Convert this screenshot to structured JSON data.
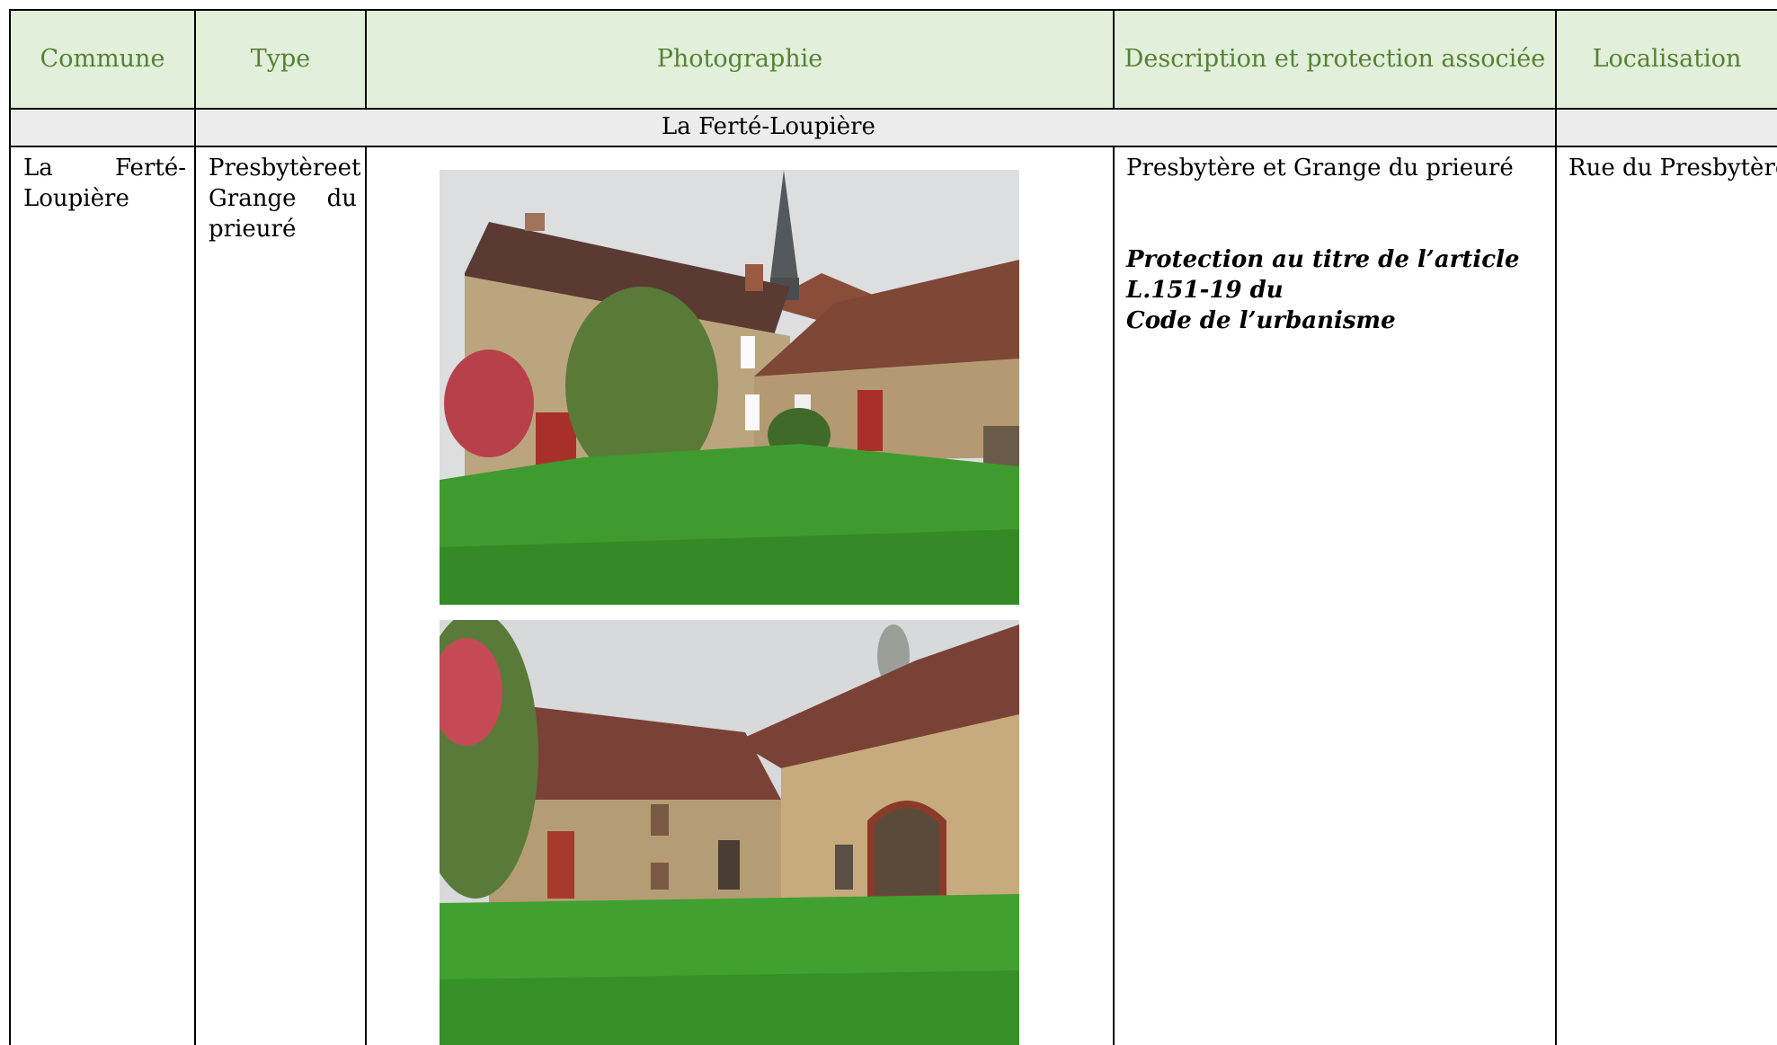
{
  "table": {
    "headers": {
      "commune": "Commune",
      "type": "Type",
      "photo": "Photographie",
      "description": "Description et protection associée",
      "location": "Localisation"
    },
    "section_title": "La Ferté-Loupière",
    "row": {
      "commune_line1_a": "La",
      "commune_line1_b": "Ferté-",
      "commune_line2": "Loupière",
      "type_line1_a": "Presbytère",
      "type_line1_b": "et",
      "type_line2_a": "Grange",
      "type_line2_b": "du",
      "type_line3": "prieuré",
      "description_title": "Presbytère et Grange du prieuré",
      "protection_line1": "Protection au titre de l’article L.151-19 du",
      "protection_line2": "Code de l’urbanisme",
      "location": "Rue du Presbytère"
    }
  },
  "colors": {
    "header_bg": "#e2efda",
    "header_text": "#548235",
    "section_bg": "#ececec"
  },
  "photos": [
    {
      "subject": "presbytery-building-with-church-spire-photo"
    },
    {
      "subject": "priory-barn-with-arched-door-photo"
    }
  ]
}
